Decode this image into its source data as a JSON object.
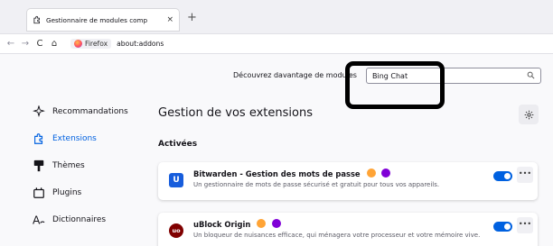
{
  "tab": {
    "title": "Gestionnaire de modules comp",
    "close": "×",
    "newtab": "+"
  },
  "navbar": {
    "back": "←",
    "forward": "→",
    "reload": "C",
    "home": "⌂",
    "identity": "Firefox",
    "url": "about:addons"
  },
  "search": {
    "label": "Découvrez davantage de modules",
    "value": "Bing Chat",
    "icon": "search-icon"
  },
  "sidebar": {
    "items": [
      {
        "label": "Recommandations",
        "icon": "sparkle-icon"
      },
      {
        "label": "Extensions",
        "icon": "puzzle-icon",
        "active": true
      },
      {
        "label": "Thèmes",
        "icon": "brush-icon"
      },
      {
        "label": "Plugins",
        "icon": "plugin-icon"
      },
      {
        "label": "Dictionnaires",
        "icon": "dictionary-icon"
      }
    ]
  },
  "main": {
    "title": "Gestion de vos extensions",
    "section": "Activées",
    "extensions": [
      {
        "name": "Bitwarden - Gestion des mots de passe",
        "description": "Un gestionnaire de mots de passe sécurisé et gratuit pour tous vos appareils.",
        "icon_text": "U",
        "icon_color": "#175ddc",
        "enabled": true
      },
      {
        "name": "uBlock Origin",
        "description": "Un bloqueur de nuisances efficace, qui ménagera votre processeur et votre mémoire vive.",
        "icon_text": "uo",
        "icon_color": "#800000",
        "enabled": true
      }
    ]
  },
  "colors": {
    "accent": "#0061e0",
    "highlight_border": "#000000"
  }
}
